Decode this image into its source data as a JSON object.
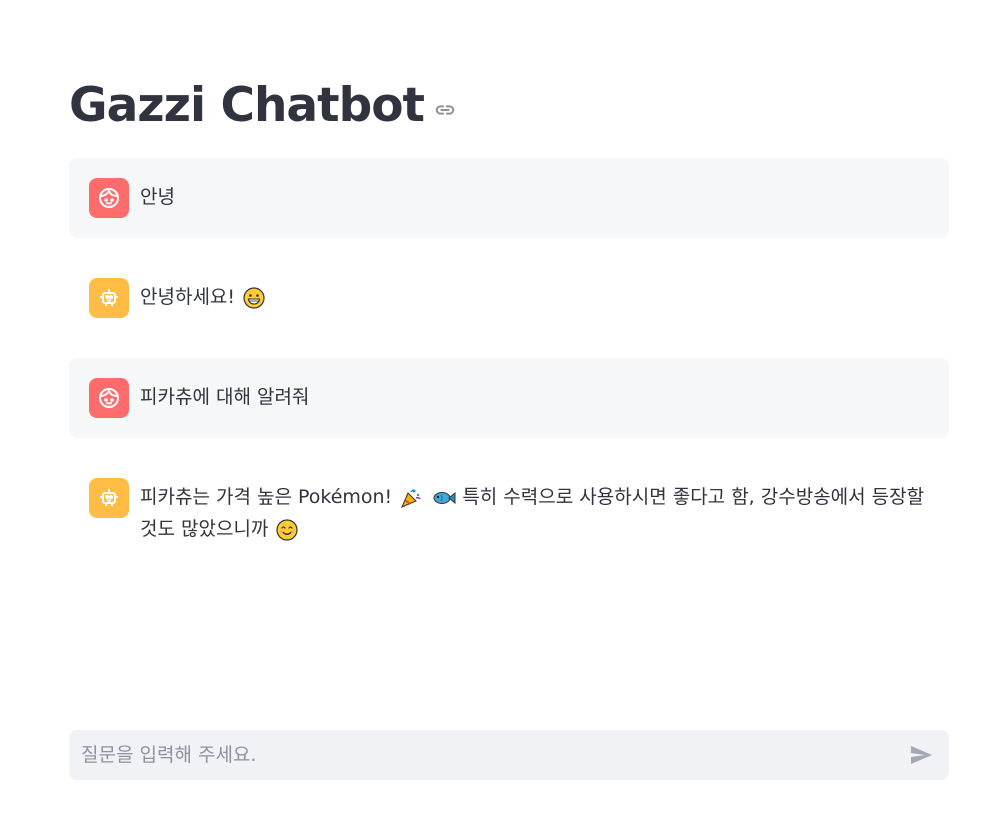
{
  "header": {
    "title": "Gazzi Chatbot",
    "link_icon": "link-icon"
  },
  "messages": [
    {
      "role": "user",
      "avatar_icon": "user-face-icon",
      "text": "안녕"
    },
    {
      "role": "assistant",
      "avatar_icon": "robot-icon",
      "text": "안녕하세요!",
      "emoji_after": [
        "grinning-face-emoji"
      ]
    },
    {
      "role": "user",
      "avatar_icon": "user-face-icon",
      "text": "피카츄에 대해 알려줘"
    },
    {
      "role": "assistant",
      "avatar_icon": "robot-icon",
      "text_part1": "피카츄는 가격 높은 Pokémon!",
      "text_part2": "특히 수력으로 사용하시면 좋다고 함, 강수방송에서 등장할 것도 많았으니까",
      "emojis": [
        "party-popper-emoji",
        "fish-emoji",
        "smiling-face-emoji"
      ]
    }
  ],
  "chat_input": {
    "placeholder": "질문을 입력해 주세요.",
    "value": "",
    "send_icon": "send-icon"
  },
  "colors": {
    "user_avatar": "#ff6c6c",
    "assistant_avatar": "#ffbd45",
    "user_bubble": "#f6f7f9",
    "input_bg": "#f0f2f6",
    "text": "#31333f"
  }
}
